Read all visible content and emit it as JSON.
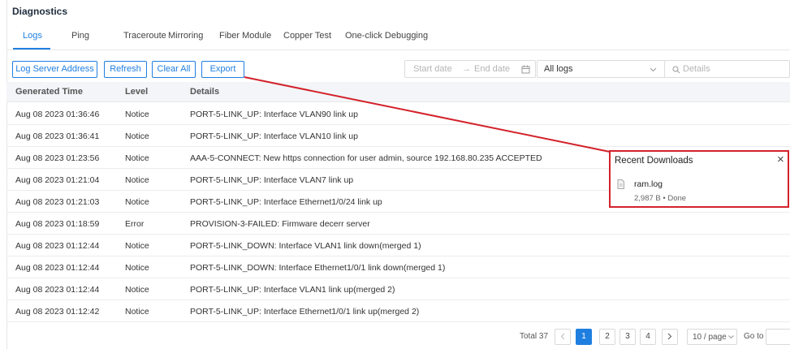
{
  "page": {
    "title": "Diagnostics"
  },
  "tabs": [
    {
      "label": "Logs"
    },
    {
      "label": "Ping"
    },
    {
      "label": "Traceroute"
    },
    {
      "label": "Mirroring"
    },
    {
      "label": "Fiber Module"
    },
    {
      "label": "Copper Test"
    },
    {
      "label": "One-click Debugging"
    }
  ],
  "toolbar": {
    "log_server_label": "Log Server Address",
    "refresh_label": "Refresh",
    "clear_all_label": "Clear All",
    "export_label": "Export",
    "start_date_placeholder": "Start date",
    "range_arrow": "→",
    "end_date_placeholder": "End date",
    "log_filter_value": "All logs",
    "search_placeholder": "Details"
  },
  "table": {
    "headers": {
      "time": "Generated Time",
      "level": "Level",
      "details": "Details"
    },
    "rows": [
      {
        "time": "Aug 08 2023 01:36:46",
        "level": "Notice",
        "details": "PORT-5-LINK_UP: Interface VLAN90 link up"
      },
      {
        "time": "Aug 08 2023 01:36:41",
        "level": "Notice",
        "details": "PORT-5-LINK_UP: Interface VLAN10 link up"
      },
      {
        "time": "Aug 08 2023 01:23:56",
        "level": "Notice",
        "details": "AAA-5-CONNECT: New https connection for user admin, source 192.168.80.235 ACCEPTED"
      },
      {
        "time": "Aug 08 2023 01:21:04",
        "level": "Notice",
        "details": "PORT-5-LINK_UP: Interface VLAN7 link up"
      },
      {
        "time": "Aug 08 2023 01:21:03",
        "level": "Notice",
        "details": "PORT-5-LINK_UP: Interface Ethernet1/0/24 link up"
      },
      {
        "time": "Aug 08 2023 01:18:59",
        "level": "Error",
        "details": "PROVISION-3-FAILED: Firmware decerr server"
      },
      {
        "time": "Aug 08 2023 01:12:44",
        "level": "Notice",
        "details": "PORT-5-LINK_DOWN: Interface VLAN1 link down(merged 1)"
      },
      {
        "time": "Aug 08 2023 01:12:44",
        "level": "Notice",
        "details": "PORT-5-LINK_DOWN: Interface Ethernet1/0/1 link down(merged 1)"
      },
      {
        "time": "Aug 08 2023 01:12:44",
        "level": "Notice",
        "details": "PORT-5-LINK_UP: Interface VLAN1 link up(merged 2)"
      },
      {
        "time": "Aug 08 2023 01:12:42",
        "level": "Notice",
        "details": "PORT-5-LINK_UP: Interface Ethernet1/0/1 link up(merged 2)"
      }
    ]
  },
  "pagination": {
    "total_label": "Total 37",
    "pages": [
      "1",
      "2",
      "3",
      "4"
    ],
    "current": "1",
    "page_size": "10 / page",
    "goto_label": "Go to"
  },
  "downloads": {
    "title": "Recent Downloads",
    "close_glyph": "×",
    "file_name": "ram.log",
    "file_meta": "2,987 B • Done"
  },
  "colors": {
    "accent": "#1f7fe0",
    "highlight": "#d3222a",
    "header_bg": "#f3f5f8"
  },
  "icons": [
    "calendar-icon",
    "chevron-down-icon",
    "search-icon",
    "file-icon",
    "close-icon",
    "chevron-left-icon",
    "chevron-right-icon"
  ]
}
